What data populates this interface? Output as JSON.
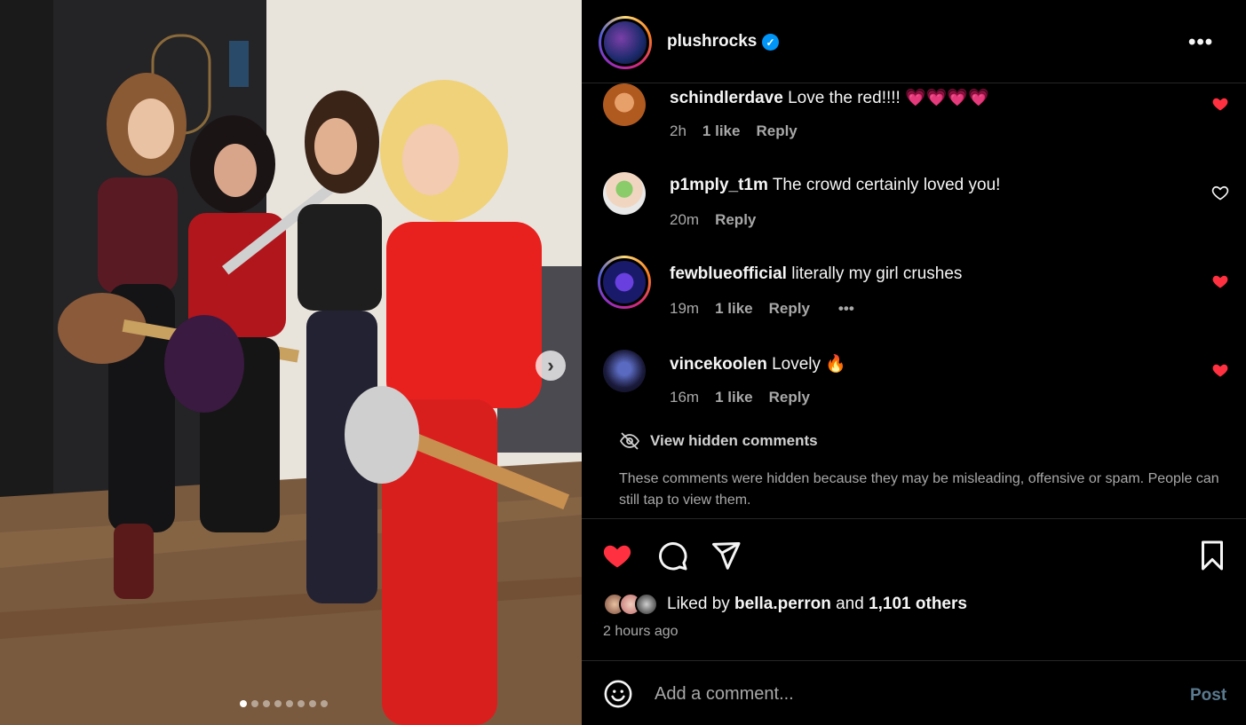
{
  "post": {
    "username": "plushrocks",
    "verified": true,
    "carousel": {
      "total": 8,
      "current": 1
    }
  },
  "comments": [
    {
      "user": "schindlerdave",
      "text": "Love the red!!!! 💗💗💗💗",
      "time": "2h",
      "likes": "1 like",
      "reply": "Reply",
      "liked": true
    },
    {
      "user": "p1mply_t1m",
      "text": "The crowd certainly loved you!",
      "time": "20m",
      "likes": "",
      "reply": "Reply",
      "liked": false
    },
    {
      "user": "fewblueofficial",
      "text": "literally my girl crushes",
      "time": "19m",
      "likes": "1 like",
      "reply": "Reply",
      "liked": true,
      "more": "•••"
    },
    {
      "user": "vincekoolen",
      "text": "Lovely 🔥",
      "time": "16m",
      "likes": "1 like",
      "reply": "Reply",
      "liked": true
    }
  ],
  "hidden": {
    "link": "View hidden comments",
    "note": "These comments were hidden because they may be misleading, offensive or spam. People can still tap to view them."
  },
  "likes": {
    "prefix": "Liked by ",
    "user": "bella.perron",
    "joiner": " and ",
    "others": "1,101 others",
    "time": "2 hours ago"
  },
  "composer": {
    "placeholder": "Add a comment...",
    "post_label": "Post"
  },
  "colors": {
    "like_red": "#ff3040",
    "verified_blue": "#0095f6",
    "post_disabled": "#5a7a8f"
  }
}
